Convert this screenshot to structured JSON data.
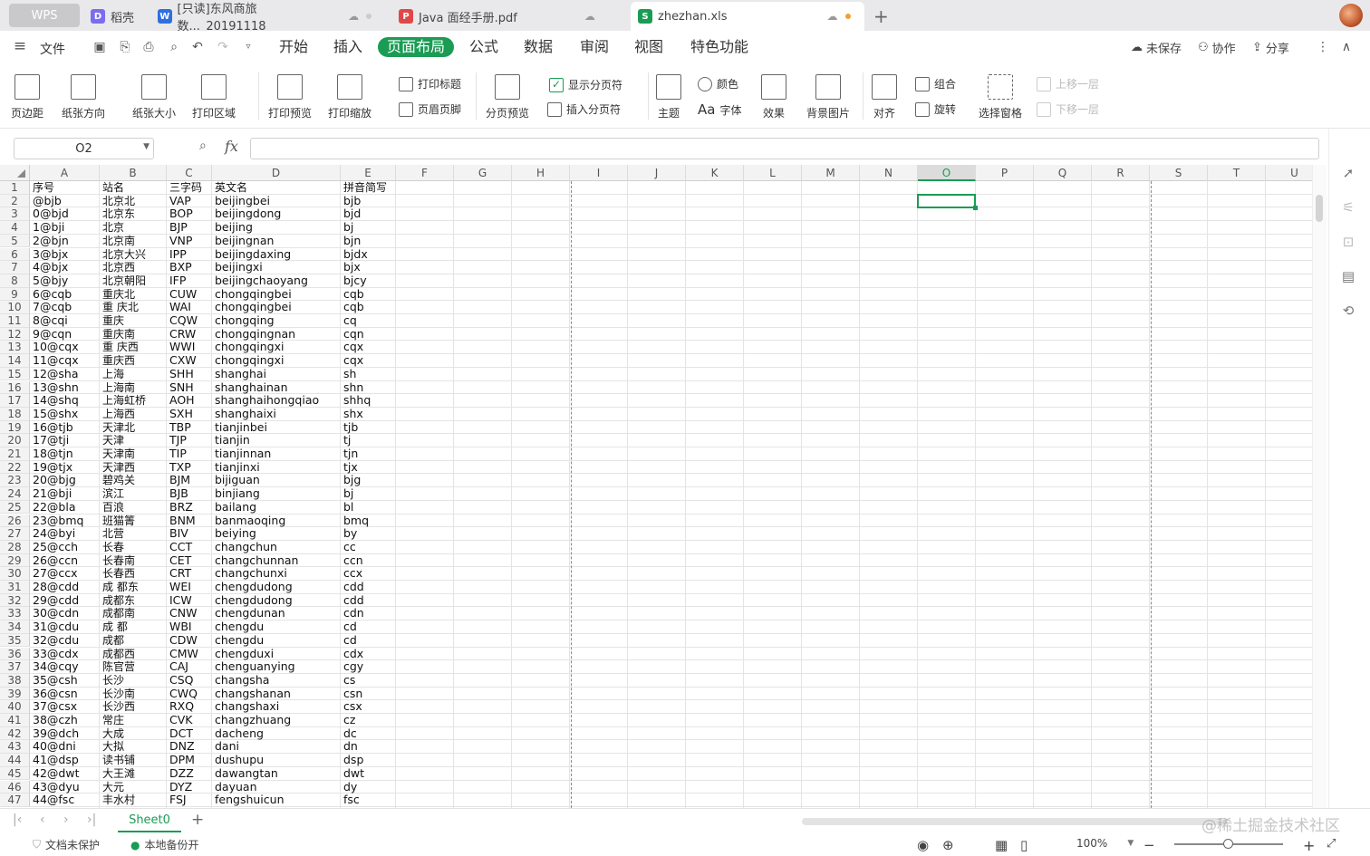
{
  "tabs": [
    {
      "label": "WPS"
    },
    {
      "label": "稻壳",
      "icon": "daoke-icon"
    },
    {
      "label": "[只读]东风商旅数..._20191118",
      "icon": "word-doc-icon"
    },
    {
      "label": "Java 面经手册.pdf",
      "icon": "pdf-icon"
    },
    {
      "label": "zhezhan.xls",
      "icon": "sheet-icon"
    }
  ],
  "menu": {
    "file": "文件",
    "items": [
      "开始",
      "插入",
      "页面布局",
      "公式",
      "数据",
      "审阅",
      "视图",
      "特色功能"
    ],
    "active_index": 2,
    "unsaved": "未保存",
    "collab": "协作",
    "share": "分享"
  },
  "ribbon": {
    "margins": "页边距",
    "orientation": "纸张方向",
    "size": "纸张大小",
    "print_area": "打印区域",
    "print_preview": "打印预览",
    "print_scale": "打印缩放",
    "print_titles": "打印标题",
    "header_footer": "页眉页脚",
    "page_break_preview": "分页预览",
    "show_page_breaks": "显示分页符",
    "insert_page_break": "插入分页符",
    "theme": "主题",
    "colors": "颜色",
    "fonts": "字体",
    "effects": "效果",
    "background": "背景图片",
    "align": "对齐",
    "group": "组合",
    "rotate": "旋转",
    "selection_pane": "选择窗格",
    "bring_forward": "上移一层",
    "send_backward": "下移一层"
  },
  "formula": {
    "name_box": "O2",
    "fx": "fx",
    "value": ""
  },
  "columns": [
    "A",
    "B",
    "C",
    "D",
    "E",
    "F",
    "G",
    "H",
    "I",
    "J",
    "K",
    "L",
    "M",
    "N",
    "O",
    "P",
    "Q",
    "R",
    "S",
    "T",
    "U"
  ],
  "selected_column": "O",
  "header_row": [
    "序号",
    "站名",
    "三字码",
    "英文名",
    "拼音简写"
  ],
  "rows": [
    [
      "@bjb",
      "北京北",
      "VAP",
      "beijingbei",
      "bjb"
    ],
    [
      "0@bjd",
      "北京东",
      "BOP",
      "beijingdong",
      "bjd"
    ],
    [
      "1@bji",
      "北京",
      "BJP",
      "beijing",
      "bj"
    ],
    [
      "2@bjn",
      "北京南",
      "VNP",
      "beijingnan",
      "bjn"
    ],
    [
      "3@bjx",
      "北京大兴",
      "IPP",
      "beijingdaxing",
      "bjdx"
    ],
    [
      "4@bjx",
      "北京西",
      "BXP",
      "beijingxi",
      "bjx"
    ],
    [
      "5@bjy",
      "北京朝阳",
      "IFP",
      "beijingchaoyang",
      "bjcy"
    ],
    [
      "6@cqb",
      "重庆北",
      "CUW",
      "chongqingbei",
      "cqb"
    ],
    [
      "7@cqb",
      "重 庆北",
      "WAI",
      "chongqingbei",
      "cqb"
    ],
    [
      "8@cqi",
      "重庆",
      "CQW",
      "chongqing",
      "cq"
    ],
    [
      "9@cqn",
      "重庆南",
      "CRW",
      "chongqingnan",
      "cqn"
    ],
    [
      "10@cqx",
      "重 庆西",
      "WWI",
      "chongqingxi",
      "cqx"
    ],
    [
      "11@cqx",
      "重庆西",
      "CXW",
      "chongqingxi",
      "cqx"
    ],
    [
      "12@sha",
      "上海",
      "SHH",
      "shanghai",
      "sh"
    ],
    [
      "13@shn",
      "上海南",
      "SNH",
      "shanghainan",
      "shn"
    ],
    [
      "14@shq",
      "上海虹桥",
      "AOH",
      "shanghaihongqiao",
      "shhq"
    ],
    [
      "15@shx",
      "上海西",
      "SXH",
      "shanghaixi",
      "shx"
    ],
    [
      "16@tjb",
      "天津北",
      "TBP",
      "tianjinbei",
      "tjb"
    ],
    [
      "17@tji",
      "天津",
      "TJP",
      "tianjin",
      "tj"
    ],
    [
      "18@tjn",
      "天津南",
      "TIP",
      "tianjinnan",
      "tjn"
    ],
    [
      "19@tjx",
      "天津西",
      "TXP",
      "tianjinxi",
      "tjx"
    ],
    [
      "20@bjg",
      "碧鸡关",
      "BJM",
      "bijiguan",
      "bjg"
    ],
    [
      "21@bji",
      "滨江",
      "BJB",
      "binjiang",
      "bj"
    ],
    [
      "22@bla",
      "百浪",
      "BRZ",
      "bailang",
      "bl"
    ],
    [
      "23@bmq",
      "班猫箐",
      "BNM",
      "banmaoqing",
      "bmq"
    ],
    [
      "24@byi",
      "北营",
      "BIV",
      "beiying",
      "by"
    ],
    [
      "25@cch",
      "长春",
      "CCT",
      "changchun",
      "cc"
    ],
    [
      "26@ccn",
      "长春南",
      "CET",
      "changchunnan",
      "ccn"
    ],
    [
      "27@ccx",
      "长春西",
      "CRT",
      "changchunxi",
      "ccx"
    ],
    [
      "28@cdd",
      "成 都东",
      "WEI",
      "chengdudong",
      "cdd"
    ],
    [
      "29@cdd",
      "成都东",
      "ICW",
      "chengdudong",
      "cdd"
    ],
    [
      "30@cdn",
      "成都南",
      "CNW",
      "chengdunan",
      "cdn"
    ],
    [
      "31@cdu",
      "成 都",
      "WBI",
      "chengdu",
      "cd"
    ],
    [
      "32@cdu",
      "成都",
      "CDW",
      "chengdu",
      "cd"
    ],
    [
      "33@cdx",
      "成都西",
      "CMW",
      "chengduxi",
      "cdx"
    ],
    [
      "34@cqy",
      "陈官营",
      "CAJ",
      "chenguanying",
      "cgy"
    ],
    [
      "35@csh",
      "长沙",
      "CSQ",
      "changsha",
      "cs"
    ],
    [
      "36@csn",
      "长沙南",
      "CWQ",
      "changshanan",
      "csn"
    ],
    [
      "37@csx",
      "长沙西",
      "RXQ",
      "changshaxi",
      "csx"
    ],
    [
      "38@czh",
      "常庄",
      "CVK",
      "changzhuang",
      "cz"
    ],
    [
      "39@dch",
      "大成",
      "DCT",
      "dacheng",
      "dc"
    ],
    [
      "40@dni",
      "大拟",
      "DNZ",
      "dani",
      "dn"
    ],
    [
      "41@dsp",
      "读书铺",
      "DPM",
      "dushupu",
      "dsp"
    ],
    [
      "42@dwt",
      "大王滩",
      "DZZ",
      "dawangtan",
      "dwt"
    ],
    [
      "43@dyu",
      "大元",
      "DYZ",
      "dayuan",
      "dy"
    ],
    [
      "44@fsc",
      "丰水村",
      "FSJ",
      "fengshuicun",
      "fsc"
    ]
  ],
  "sheet_tab": "Sheet0",
  "status": {
    "protect": "文档未保护",
    "backup": "本地备份开",
    "zoom": "100%"
  },
  "watermark": "@稀土掘金技术社区",
  "colors": {
    "accent": "#1a9c54"
  }
}
